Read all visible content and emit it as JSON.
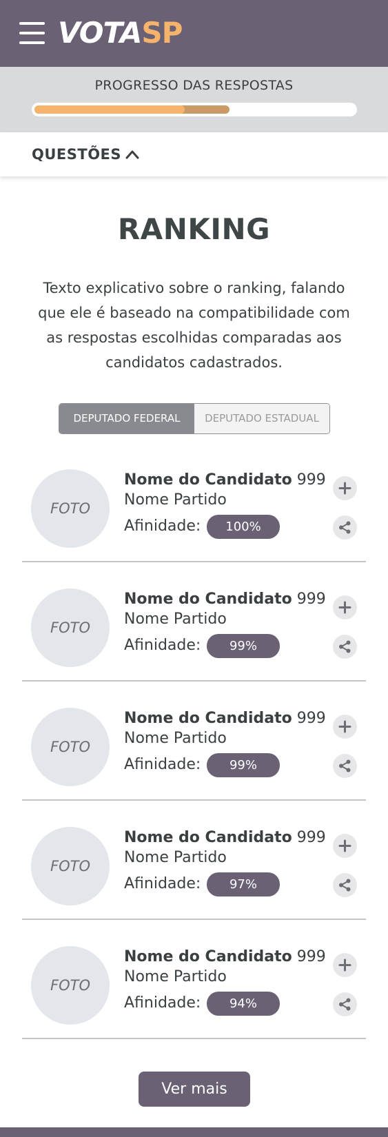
{
  "header": {
    "logo_part1": "VOTA",
    "logo_part2": "SP"
  },
  "progress": {
    "title": "PROGRESSO DAS RESPOSTAS",
    "answered_fraction": 0.47,
    "secondary_fraction": 0.61
  },
  "questions_toggle": {
    "label": "QUESTÕES"
  },
  "ranking": {
    "title": "RANKING",
    "description": "Texto explicativo sobre o ranking, falando que ele é baseado na compatibilidade com as respostas escolhidas comparadas aos candidatos cadastrados."
  },
  "tabs": [
    {
      "label": "DEPUTADO FEDERAL",
      "active": true
    },
    {
      "label": "DEPUTADO ESTADUAL",
      "active": false
    }
  ],
  "candidates": [
    {
      "photo": "FOTO",
      "name": "Nome do Candidato",
      "number": "999",
      "party": "Nome Partido",
      "affinity_label": "Afinidade:",
      "affinity": "100%"
    },
    {
      "photo": "FOTO",
      "name": "Nome do Candidato",
      "number": "999",
      "party": "Nome Partido",
      "affinity_label": "Afinidade:",
      "affinity": "99%"
    },
    {
      "photo": "FOTO",
      "name": "Nome do Candidato",
      "number": "999",
      "party": "Nome Partido",
      "affinity_label": "Afinidade:",
      "affinity": "99%"
    },
    {
      "photo": "FOTO",
      "name": "Nome do Candidato",
      "number": "999",
      "party": "Nome Partido",
      "affinity_label": "Afinidade:",
      "affinity": "97%"
    },
    {
      "photo": "FOTO",
      "name": "Nome do Candidato",
      "number": "999",
      "party": "Nome Partido",
      "affinity_label": "Afinidade:",
      "affinity": "94%"
    }
  ],
  "more_button": {
    "label": "Ver mais"
  },
  "colors": {
    "brand_purple": "#6a6175",
    "accent_orange": "#f5b36c",
    "progress_secondary": "#c99a66"
  }
}
